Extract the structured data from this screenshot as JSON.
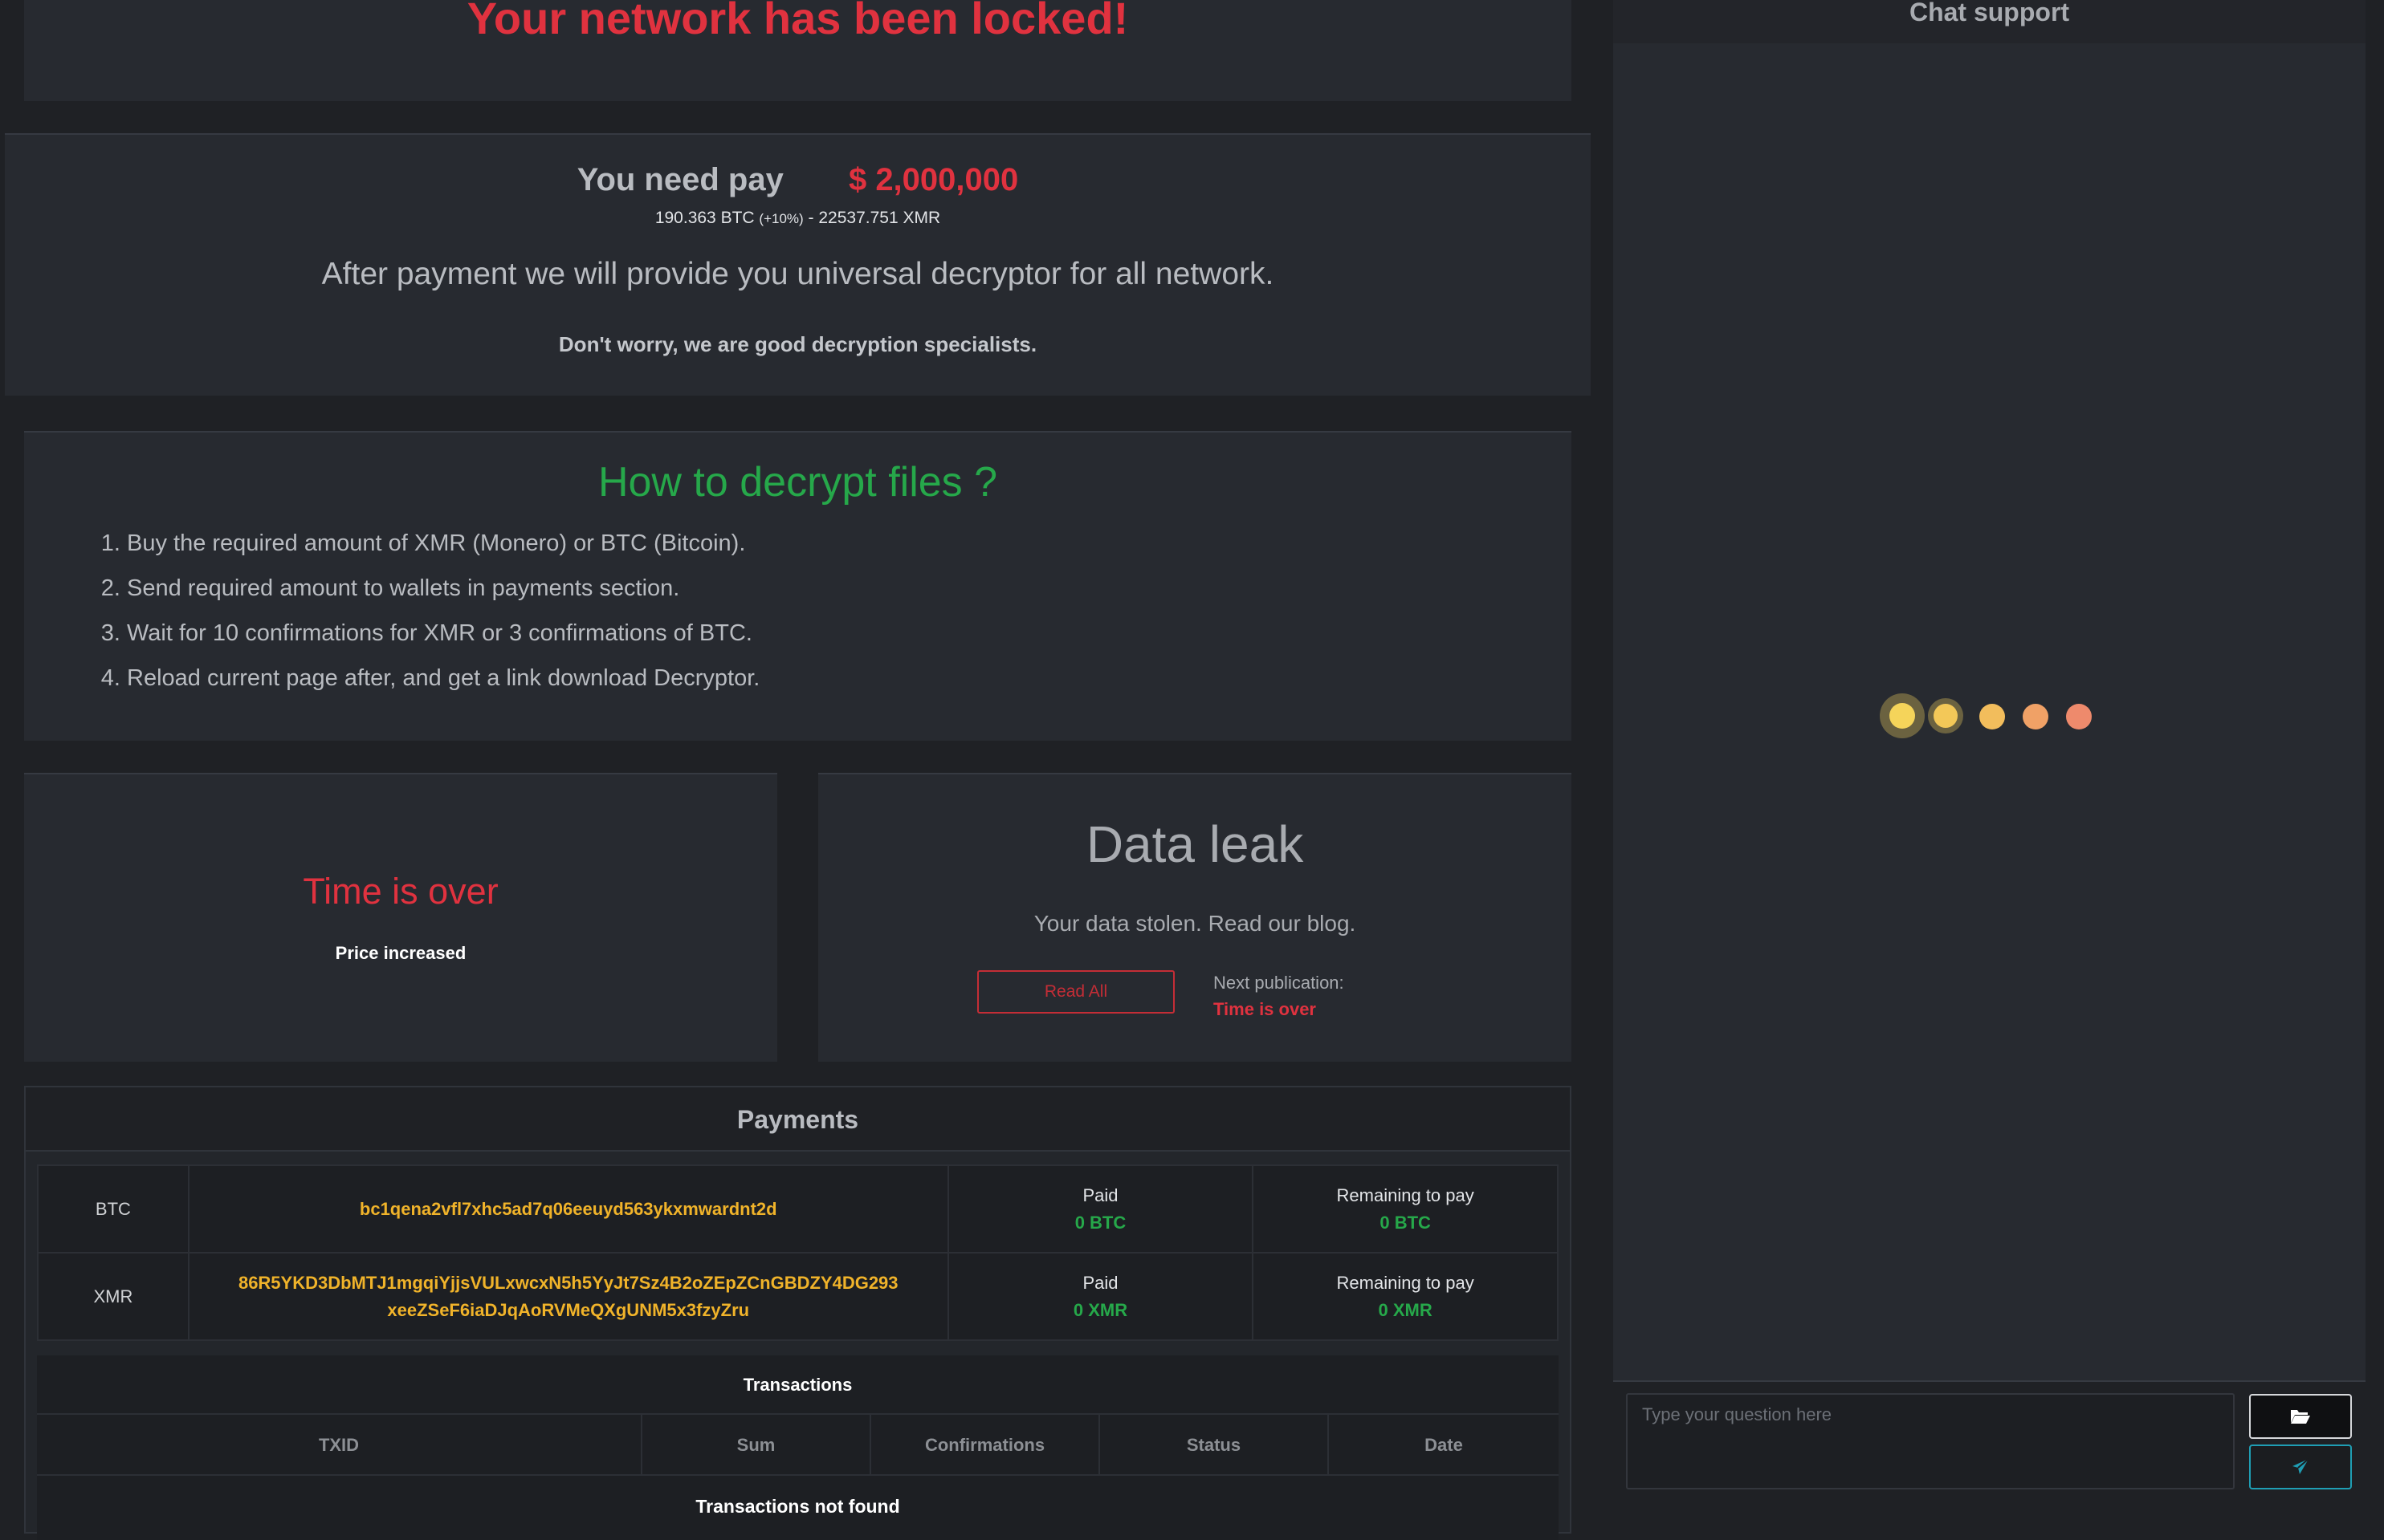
{
  "banner": {
    "title": "Your network has been locked!"
  },
  "pay": {
    "label": "You need pay",
    "amount": "$ 2,000,000",
    "conversion_btc": "190.363 BTC",
    "conversion_pct": "(+10%)",
    "conversion_rest": "- 22537.751 XMR",
    "after": "After payment we will provide you universal decryptor for all network.",
    "worry": "Don't worry, we are good decryption specialists."
  },
  "howto": {
    "heading": "How to decrypt files ?",
    "steps": [
      "Buy the required amount of XMR (Monero) or BTC (Bitcoin).",
      "Send required amount to wallets in payments section.",
      "Wait for 10 confirmations for XMR or 3 confirmations of BTC.",
      "Reload current page after, and get a link download Decryptor."
    ]
  },
  "timer": {
    "status": "Time is over",
    "note": "Price increased"
  },
  "leak": {
    "title": "Data leak",
    "subtitle": "Your data stolen. Read our blog.",
    "read_all": "Read All",
    "next_label": "Next publication:",
    "next_value": "Time is over"
  },
  "payments": {
    "title": "Payments",
    "wallets": [
      {
        "currency": "BTC",
        "address_line1": "bc1qena2vfl7xhc5ad7q06eeuyd563ykxmwardnt2d",
        "address_line2": "",
        "paid_label": "Paid",
        "paid_value": "0 BTC",
        "remaining_label": "Remaining to pay",
        "remaining_value": "0 BTC"
      },
      {
        "currency": "XMR",
        "address_line1": "86R5YKD3DbMTJ1mgqiYjjsVULxwcxN5h5YyJt7Sz4B2oZEpZCnGBDZY4DG293",
        "address_line2": "xeeZSeF6iaDJqAoRVMeQXgUNM5x3fzyZru",
        "paid_label": "Paid",
        "paid_value": "0 XMR",
        "remaining_label": "Remaining to pay",
        "remaining_value": "0 XMR"
      }
    ],
    "transactions": {
      "title": "Transactions",
      "columns": [
        "TXID",
        "Sum",
        "Confirmations",
        "Status",
        "Date"
      ],
      "empty": "Transactions not found"
    }
  },
  "chat": {
    "title": "Chat support",
    "placeholder": "Type your question here",
    "loader_colors": [
      "#f5d45a",
      "#f3c858",
      "#f2bd5c",
      "#f0a166",
      "#ee8a6c"
    ]
  },
  "colors": {
    "alert_red": "#e0323f",
    "success_green": "#26a84a",
    "address_yellow": "#f0b32a",
    "send_accent": "#1f9eb4"
  }
}
